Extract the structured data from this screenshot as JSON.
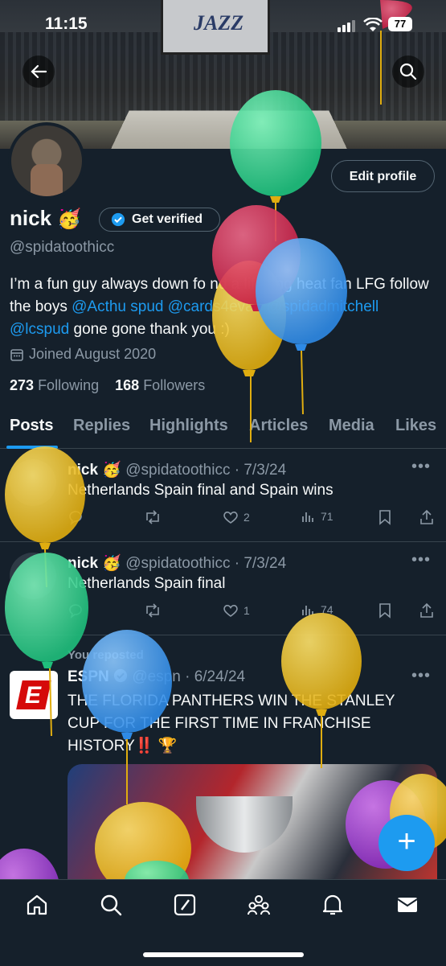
{
  "status_bar": {
    "time": "11:15",
    "battery": "77"
  },
  "banner": {
    "scoreboard_text": "JAZZ"
  },
  "profile": {
    "edit_label": "Edit profile",
    "name": "nick",
    "name_emoji": "🥳",
    "verified_label": "Get verified",
    "handle": "@spidatoothicc",
    "bio_parts": {
      "t1": "I’m a fun guy always down fo",
      "t2": "nd a lifelong heat fan LFG follow the boys ",
      "m1": "@Acthu",
      "m1b": "spud",
      "m2": "@cards4eva1",
      "m3": "@spidadmitchell",
      "m4": "@lcspud",
      "t3": " gone gone thank you :)"
    },
    "joined": "Joined August 2020",
    "following_count": "273",
    "following_label": "Following",
    "followers_count": "168",
    "followers_label": "Followers"
  },
  "tabs": [
    "Posts",
    "Replies",
    "Highlights",
    "Articles",
    "Media",
    "Likes"
  ],
  "posts": [
    {
      "name": "nick",
      "emoji": "🥳",
      "handle": "@spidatoothicc",
      "date": "7/3/24",
      "text": "Netherlands Spain final and Spain wins",
      "likes": "2",
      "views": "71"
    },
    {
      "name": "nick",
      "emoji": "🥳",
      "handle": "@spidatoothicc",
      "date": "7/3/24",
      "text": "Netherlands Spain final",
      "likes": "1",
      "views": "74"
    },
    {
      "repost_label": "You reposted",
      "name": "ESPN",
      "handle": "@espn",
      "date": "6/24/24",
      "text": "THE FLORIDA PANTHERS WIN THE STANLEY CUP FOR THE FIRST TIME IN FRANCHISE HISTORY‼️ 🏆",
      "logo_letter": "E"
    }
  ],
  "colors": {
    "accent": "#1d9bf0",
    "background": "#15202b",
    "muted": "#8b98a5"
  }
}
